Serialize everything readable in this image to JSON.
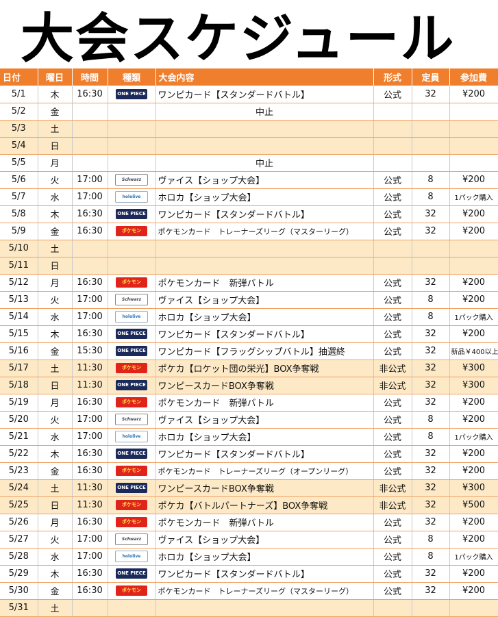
{
  "title": "大会スケジュール",
  "headers": [
    "日付",
    "曜日",
    "時間",
    "種類",
    "大会内容",
    "形式",
    "定員",
    "参加費"
  ],
  "logos": {
    "onepiece": "ONE PIECE",
    "pokemon": "ポケモン",
    "hololive": "hololive",
    "schwarz": "Schwarz"
  },
  "rows": [
    {
      "date": "5/1",
      "day": "木",
      "time": "16:30",
      "kind": "onepiece",
      "content": "ワンピカード【スタンダードバトル】",
      "format": "公式",
      "cap": "32",
      "fee": "¥200"
    },
    {
      "date": "5/2",
      "day": "金",
      "time": "",
      "kind": "",
      "content": "中止",
      "format": "",
      "cap": "",
      "fee": "",
      "note": true
    },
    {
      "date": "5/3",
      "day": "土",
      "time": "",
      "kind": "",
      "content": "",
      "format": "",
      "cap": "",
      "fee": "",
      "weekend": true
    },
    {
      "date": "5/4",
      "day": "日",
      "time": "",
      "kind": "",
      "content": "",
      "format": "",
      "cap": "",
      "fee": "",
      "weekend": true
    },
    {
      "date": "5/5",
      "day": "月",
      "time": "",
      "kind": "",
      "content": "中止",
      "format": "",
      "cap": "",
      "fee": "",
      "note": true
    },
    {
      "date": "5/6",
      "day": "火",
      "time": "17:00",
      "kind": "schwarz",
      "content": "ヴァイス【ショップ大会】",
      "format": "公式",
      "cap": "8",
      "fee": "¥200"
    },
    {
      "date": "5/7",
      "day": "水",
      "time": "17:00",
      "kind": "hololive",
      "content": "ホロカ【ショップ大会】",
      "format": "公式",
      "cap": "8",
      "fee": "1パック購入",
      "smallfee": true
    },
    {
      "date": "5/8",
      "day": "木",
      "time": "16:30",
      "kind": "onepiece",
      "content": "ワンピカード【スタンダードバトル】",
      "format": "公式",
      "cap": "32",
      "fee": "¥200"
    },
    {
      "date": "5/9",
      "day": "金",
      "time": "16:30",
      "kind": "pokemon",
      "content": "ポケモンカード　トレーナーズリーグ（マスターリーグ）",
      "format": "公式",
      "cap": "32",
      "fee": "¥200",
      "small": true
    },
    {
      "date": "5/10",
      "day": "土",
      "time": "",
      "kind": "",
      "content": "",
      "format": "",
      "cap": "",
      "fee": "",
      "weekend": true
    },
    {
      "date": "5/11",
      "day": "日",
      "time": "",
      "kind": "",
      "content": "",
      "format": "",
      "cap": "",
      "fee": "",
      "weekend": true
    },
    {
      "date": "5/12",
      "day": "月",
      "time": "16:30",
      "kind": "pokemon",
      "content": "ポケモンカード　新弾バトル",
      "format": "公式",
      "cap": "32",
      "fee": "¥200"
    },
    {
      "date": "5/13",
      "day": "火",
      "time": "17:00",
      "kind": "schwarz",
      "content": "ヴァイス【ショップ大会】",
      "format": "公式",
      "cap": "8",
      "fee": "¥200"
    },
    {
      "date": "5/14",
      "day": "水",
      "time": "17:00",
      "kind": "hololive",
      "content": "ホロカ【ショップ大会】",
      "format": "公式",
      "cap": "8",
      "fee": "1パック購入",
      "smallfee": true
    },
    {
      "date": "5/15",
      "day": "木",
      "time": "16:30",
      "kind": "onepiece",
      "content": "ワンピカード【スタンダードバトル】",
      "format": "公式",
      "cap": "32",
      "fee": "¥200"
    },
    {
      "date": "5/16",
      "day": "金",
      "time": "15:30",
      "kind": "onepiece",
      "content": "ワンピカード【フラッグシップバトル】抽選終",
      "format": "公式",
      "cap": "32",
      "fee": "新品￥400以上",
      "smallfee": true
    },
    {
      "date": "5/17",
      "day": "土",
      "time": "11:30",
      "kind": "pokemon",
      "content": "ポケカ【ロケット団の栄光】BOX争奪戦",
      "format": "非公式",
      "cap": "32",
      "fee": "¥300",
      "weekend": true
    },
    {
      "date": "5/18",
      "day": "日",
      "time": "11:30",
      "kind": "onepiece",
      "content": "ワンピースカードBOX争奪戦",
      "format": "非公式",
      "cap": "32",
      "fee": "¥300",
      "weekend": true
    },
    {
      "date": "5/19",
      "day": "月",
      "time": "16:30",
      "kind": "pokemon",
      "content": "ポケモンカード　新弾バトル",
      "format": "公式",
      "cap": "32",
      "fee": "¥200"
    },
    {
      "date": "5/20",
      "day": "火",
      "time": "17:00",
      "kind": "schwarz",
      "content": "ヴァイス【ショップ大会】",
      "format": "公式",
      "cap": "8",
      "fee": "¥200"
    },
    {
      "date": "5/21",
      "day": "水",
      "time": "17:00",
      "kind": "hololive",
      "content": "ホロカ【ショップ大会】",
      "format": "公式",
      "cap": "8",
      "fee": "1パック購入",
      "smallfee": true
    },
    {
      "date": "5/22",
      "day": "木",
      "time": "16:30",
      "kind": "onepiece",
      "content": "ワンピカード【スタンダードバトル】",
      "format": "公式",
      "cap": "32",
      "fee": "¥200"
    },
    {
      "date": "5/23",
      "day": "金",
      "time": "16:30",
      "kind": "pokemon",
      "content": "ポケモンカード　トレーナーズリーグ（オープンリーグ）",
      "format": "公式",
      "cap": "32",
      "fee": "¥200",
      "small": true
    },
    {
      "date": "5/24",
      "day": "土",
      "time": "11:30",
      "kind": "onepiece",
      "content": "ワンピースカードBOX争奪戦",
      "format": "非公式",
      "cap": "32",
      "fee": "¥300",
      "weekend": true
    },
    {
      "date": "5/25",
      "day": "日",
      "time": "11:30",
      "kind": "pokemon",
      "content": "ポケカ【バトルパートナーズ】BOX争奪戦",
      "format": "非公式",
      "cap": "32",
      "fee": "¥500",
      "weekend": true
    },
    {
      "date": "5/26",
      "day": "月",
      "time": "16:30",
      "kind": "pokemon",
      "content": "ポケモンカード　新弾バトル",
      "format": "公式",
      "cap": "32",
      "fee": "¥200"
    },
    {
      "date": "5/27",
      "day": "火",
      "time": "17:00",
      "kind": "schwarz",
      "content": "ヴァイス【ショップ大会】",
      "format": "公式",
      "cap": "8",
      "fee": "¥200"
    },
    {
      "date": "5/28",
      "day": "水",
      "time": "17:00",
      "kind": "hololive",
      "content": "ホロカ【ショップ大会】",
      "format": "公式",
      "cap": "8",
      "fee": "1パック購入",
      "smallfee": true
    },
    {
      "date": "5/29",
      "day": "木",
      "time": "16:30",
      "kind": "onepiece",
      "content": "ワンピカード【スタンダードバトル】",
      "format": "公式",
      "cap": "32",
      "fee": "¥200"
    },
    {
      "date": "5/30",
      "day": "金",
      "time": "16:30",
      "kind": "pokemon",
      "content": "ポケモンカード　トレーナーズリーグ（マスターリーグ）",
      "format": "公式",
      "cap": "32",
      "fee": "¥200",
      "small": true
    },
    {
      "date": "5/31",
      "day": "土",
      "time": "",
      "kind": "",
      "content": "",
      "format": "",
      "cap": "",
      "fee": "",
      "weekend": true
    }
  ]
}
